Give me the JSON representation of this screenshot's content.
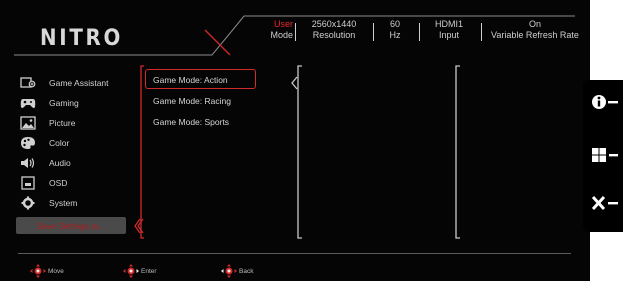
{
  "brand": {
    "logo": "NITRO"
  },
  "status_bar": [
    {
      "line1": "User",
      "line2": "Mode"
    },
    {
      "line1": "2560x1440",
      "line2": "Resolution"
    },
    {
      "line1": "60",
      "line2": "Hz"
    },
    {
      "line1": "HDMI1",
      "line2": "Input"
    },
    {
      "line1": "On",
      "line2": "Variable Refresh Rate"
    }
  ],
  "menu": {
    "items": [
      {
        "label": "Game Assistant",
        "icon": "game-assistant-icon"
      },
      {
        "label": "Gaming",
        "icon": "gamepad-icon"
      },
      {
        "label": "Picture",
        "icon": "picture-icon"
      },
      {
        "label": "Color",
        "icon": "palette-icon"
      },
      {
        "label": "Audio",
        "icon": "speaker-icon"
      },
      {
        "label": "OSD",
        "icon": "osd-icon"
      },
      {
        "label": "System",
        "icon": "gear-icon"
      }
    ],
    "save": "Save Settings to..."
  },
  "submenu": {
    "items": [
      "Game Mode: Action",
      "Game Mode: Racing",
      "Game Mode: Sports"
    ],
    "selected_index": 0
  },
  "nav": {
    "move": "Move",
    "enter": "Enter",
    "back": "Back"
  },
  "side_buttons": [
    {
      "icon": "info-icon"
    },
    {
      "icon": "grid-icon"
    },
    {
      "icon": "close-icon"
    }
  ],
  "colors": {
    "accent": "#e8282a",
    "background": "#050505",
    "text": "#d0d0d0"
  }
}
